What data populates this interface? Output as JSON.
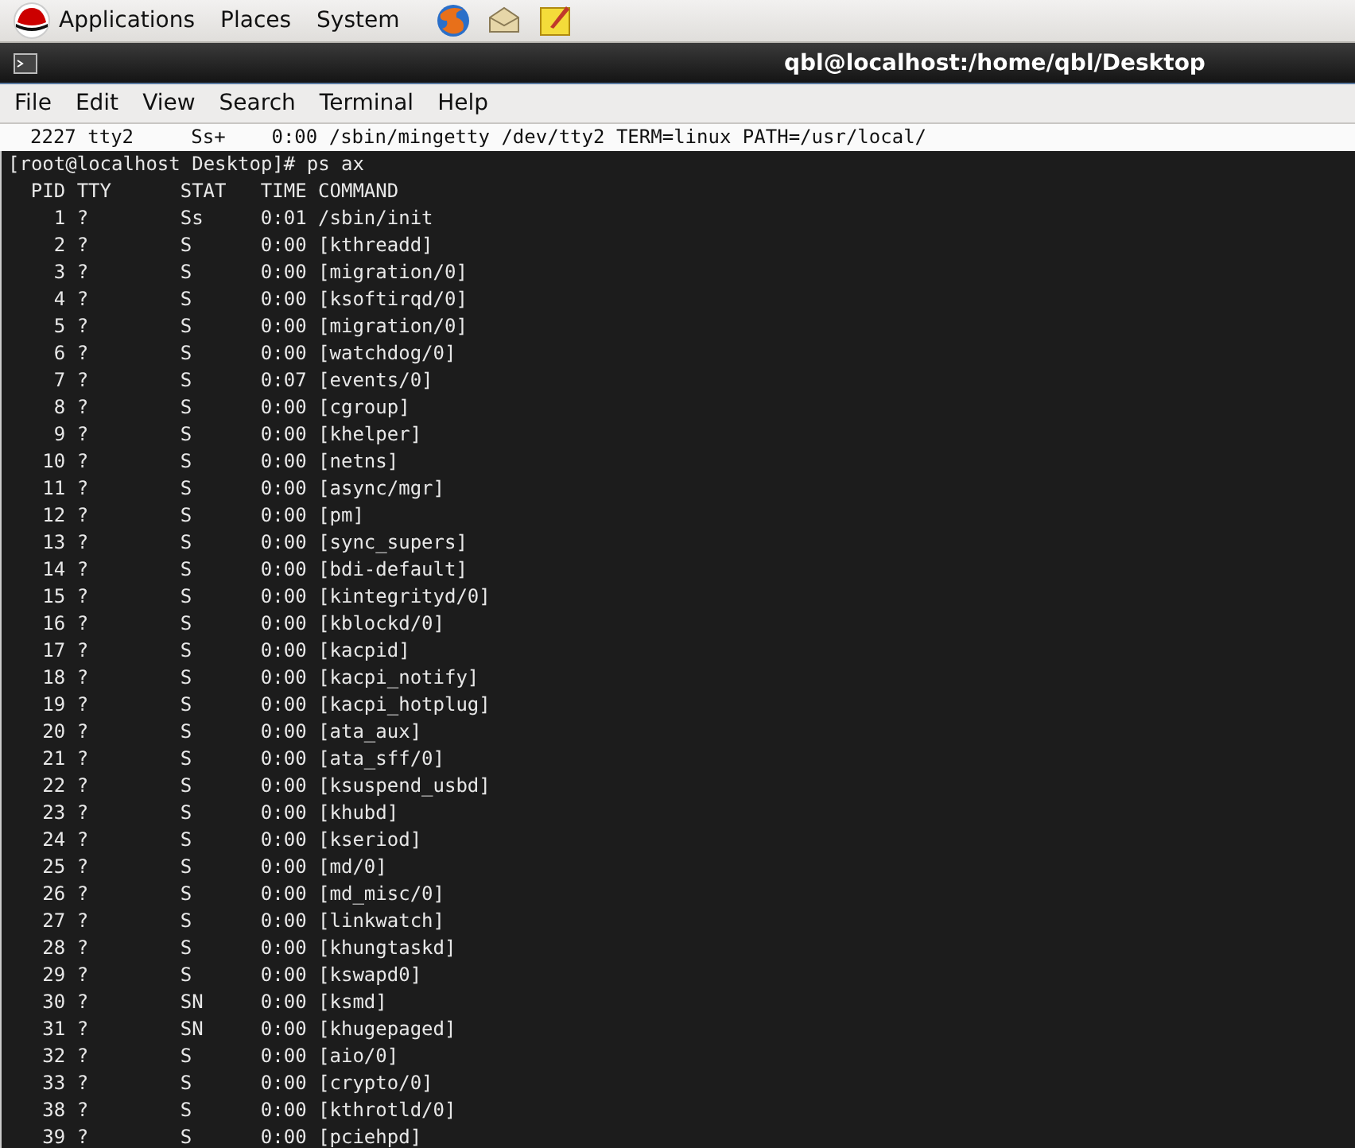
{
  "top_panel": {
    "menus": [
      "Applications",
      "Places",
      "System"
    ]
  },
  "window": {
    "title": "qbl@localhost:/home/qbl/Desktop"
  },
  "menu_bar": [
    "File",
    "Edit",
    "View",
    "Search",
    "Terminal",
    "Help"
  ],
  "terminal": {
    "highlighted_line": "2227 tty2     Ss+    0:00 /sbin/mingetty /dev/tty2 TERM=linux PATH=/usr/local/",
    "prompt": "[root@localhost Desktop]# ps ax",
    "columns": [
      "PID",
      "TTY",
      "STAT",
      "TIME",
      "COMMAND"
    ],
    "rows": [
      [
        "1",
        "?",
        "Ss",
        "0:01",
        "/sbin/init"
      ],
      [
        "2",
        "?",
        "S",
        "0:00",
        "[kthreadd]"
      ],
      [
        "3",
        "?",
        "S",
        "0:00",
        "[migration/0]"
      ],
      [
        "4",
        "?",
        "S",
        "0:00",
        "[ksoftirqd/0]"
      ],
      [
        "5",
        "?",
        "S",
        "0:00",
        "[migration/0]"
      ],
      [
        "6",
        "?",
        "S",
        "0:00",
        "[watchdog/0]"
      ],
      [
        "7",
        "?",
        "S",
        "0:07",
        "[events/0]"
      ],
      [
        "8",
        "?",
        "S",
        "0:00",
        "[cgroup]"
      ],
      [
        "9",
        "?",
        "S",
        "0:00",
        "[khelper]"
      ],
      [
        "10",
        "?",
        "S",
        "0:00",
        "[netns]"
      ],
      [
        "11",
        "?",
        "S",
        "0:00",
        "[async/mgr]"
      ],
      [
        "12",
        "?",
        "S",
        "0:00",
        "[pm]"
      ],
      [
        "13",
        "?",
        "S",
        "0:00",
        "[sync_supers]"
      ],
      [
        "14",
        "?",
        "S",
        "0:00",
        "[bdi-default]"
      ],
      [
        "15",
        "?",
        "S",
        "0:00",
        "[kintegrityd/0]"
      ],
      [
        "16",
        "?",
        "S",
        "0:00",
        "[kblockd/0]"
      ],
      [
        "17",
        "?",
        "S",
        "0:00",
        "[kacpid]"
      ],
      [
        "18",
        "?",
        "S",
        "0:00",
        "[kacpi_notify]"
      ],
      [
        "19",
        "?",
        "S",
        "0:00",
        "[kacpi_hotplug]"
      ],
      [
        "20",
        "?",
        "S",
        "0:00",
        "[ata_aux]"
      ],
      [
        "21",
        "?",
        "S",
        "0:00",
        "[ata_sff/0]"
      ],
      [
        "22",
        "?",
        "S",
        "0:00",
        "[ksuspend_usbd]"
      ],
      [
        "23",
        "?",
        "S",
        "0:00",
        "[khubd]"
      ],
      [
        "24",
        "?",
        "S",
        "0:00",
        "[kseriod]"
      ],
      [
        "25",
        "?",
        "S",
        "0:00",
        "[md/0]"
      ],
      [
        "26",
        "?",
        "S",
        "0:00",
        "[md_misc/0]"
      ],
      [
        "27",
        "?",
        "S",
        "0:00",
        "[linkwatch]"
      ],
      [
        "28",
        "?",
        "S",
        "0:00",
        "[khungtaskd]"
      ],
      [
        "29",
        "?",
        "S",
        "0:00",
        "[kswapd0]"
      ],
      [
        "30",
        "?",
        "SN",
        "0:00",
        "[ksmd]"
      ],
      [
        "31",
        "?",
        "SN",
        "0:00",
        "[khugepaged]"
      ],
      [
        "32",
        "?",
        "S",
        "0:00",
        "[aio/0]"
      ],
      [
        "33",
        "?",
        "S",
        "0:00",
        "[crypto/0]"
      ],
      [
        "38",
        "?",
        "S",
        "0:00",
        "[kthrotld/0]"
      ],
      [
        "39",
        "?",
        "S",
        "0:00",
        "[pciehpd]"
      ]
    ]
  }
}
